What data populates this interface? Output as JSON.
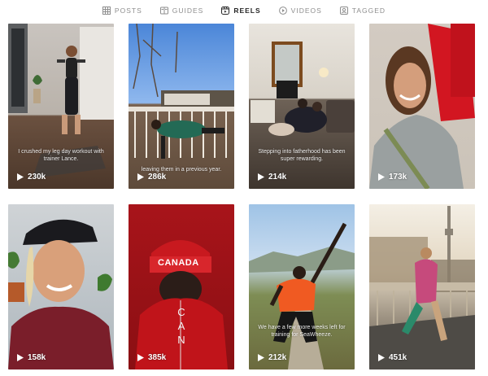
{
  "tabs": [
    {
      "label": "POSTS",
      "icon": "grid-icon"
    },
    {
      "label": "GUIDES",
      "icon": "guide-icon"
    },
    {
      "label": "REELS",
      "icon": "reels-icon",
      "active": true
    },
    {
      "label": "VIDEOS",
      "icon": "video-play-icon"
    },
    {
      "label": "TAGGED",
      "icon": "tag-person-icon"
    }
  ],
  "reels": [
    {
      "caption": "I crushed my leg day workout with trainer Lance.",
      "views": "230k"
    },
    {
      "caption": "leaving them in a previous year.",
      "views": "286k"
    },
    {
      "caption": "Stepping into fatherhood has been super rewarding.",
      "views": "214k"
    },
    {
      "caption": "",
      "views": "173k"
    },
    {
      "caption": "",
      "views": "158k"
    },
    {
      "caption": "",
      "views": "385k",
      "overlay_top": "CANADA",
      "overlay_vertical": "CAN"
    },
    {
      "caption": "We have a few more weeks left for training for SeaWheeze.",
      "views": "212k"
    },
    {
      "caption": "",
      "views": "451k"
    }
  ],
  "colors": {
    "active_tab": "#262626",
    "inactive_tab": "#8e8e8e",
    "canada_red": "#b3141a"
  }
}
